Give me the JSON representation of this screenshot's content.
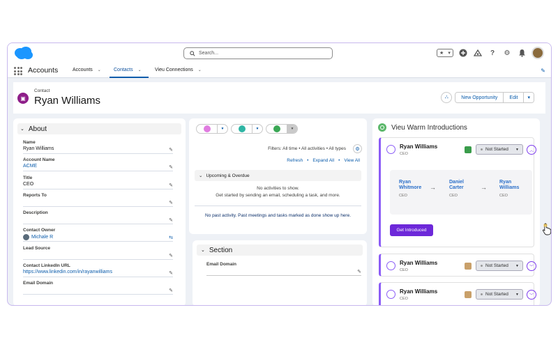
{
  "app": {
    "search_placeholder": "Search...",
    "name": "Accounts",
    "nav": [
      {
        "label": "Accounts",
        "active": false
      },
      {
        "label": "Contacts",
        "active": true
      },
      {
        "label": "Vieu Connections",
        "active": false
      }
    ]
  },
  "record": {
    "object_label": "Contact",
    "title": "Ryan Williams",
    "buttons": {
      "new_opportunity": "New Opportunity",
      "edit": "Edit"
    }
  },
  "about": {
    "heading": "About",
    "fields": [
      {
        "label": "Name",
        "value": "Ryan Williams",
        "link": false
      },
      {
        "label": "Account Name",
        "value": "ACME",
        "link": true
      },
      {
        "label": "Title",
        "value": "CEO",
        "link": false
      },
      {
        "label": "Reports To",
        "value": "",
        "link": false
      },
      {
        "label": "Description",
        "value": "",
        "link": false
      },
      {
        "label": "Contact Owner",
        "value": "Michale R",
        "link": true
      },
      {
        "label": "Lead Source",
        "value": "",
        "link": false
      },
      {
        "label": "Contact LinkedIn URL",
        "value": "https://www.linkedin.com/in/rayanwilliams",
        "link": true
      },
      {
        "label": "Email Domain",
        "value": "",
        "link": false
      }
    ]
  },
  "activity": {
    "filters": "Filters: All time • All activities • All types",
    "links": [
      "Refresh",
      "Expand All",
      "View All"
    ],
    "upcoming": "Upcoming & Overdue",
    "no_activities": "No activities to show.",
    "get_started": "Get started by sending an email, scheduling a task, and more.",
    "no_past": "No past activity. Past meetings and tasks marked as done show up here."
  },
  "section": {
    "heading": "Section",
    "field_label": "Email Domain"
  },
  "vieu": {
    "title": "Vieu Warm Introductions",
    "cards": [
      {
        "name": "Ryan Williams",
        "role": "CEO",
        "status": "Not Started",
        "expanded": true,
        "score_color": "#3a9c4b"
      },
      {
        "name": "Ryan Williams",
        "role": "CEO",
        "status": "Not Started",
        "expanded": false,
        "score_color": "#c9a06a"
      },
      {
        "name": "Ryan Williams",
        "role": "CEO",
        "status": "Not Started",
        "expanded": false,
        "score_color": "#c9a06a"
      }
    ],
    "chain": [
      {
        "name_l1": "Ryan",
        "name_l2": "Whitmore",
        "role": "CEO"
      },
      {
        "name_l1": "Daniel",
        "name_l2": "Carter",
        "role": "CEO"
      },
      {
        "name_l1": "Ryan",
        "name_l2": "Williams",
        "role": "CEO"
      }
    ],
    "intro_button": "Get Introduced"
  },
  "colors": {
    "accent": "#6d28d9",
    "link": "#0b5cab",
    "salesforce_blue": "#1b96ff"
  }
}
